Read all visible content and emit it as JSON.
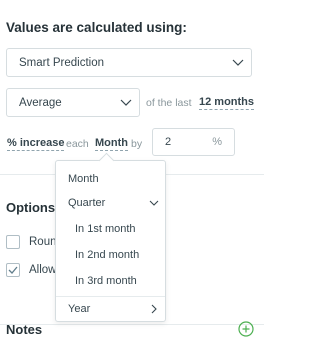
{
  "heading": "Values are calculated using:",
  "method_select": {
    "value": "Smart Prediction"
  },
  "aggregation_select": {
    "value": "Average"
  },
  "of_the_last": "of the last",
  "months_link": "12 months",
  "increase_link": "% increase",
  "each_text": "each",
  "period_link": "Month",
  "by_text": "by",
  "value_input": {
    "value": "2",
    "unit": "%"
  },
  "options": {
    "title": "Options",
    "round_label": "Roun",
    "round_checked": false,
    "allow_label": "Allow",
    "allow_checked": true
  },
  "notes": {
    "title": "Notes"
  },
  "period_menu": {
    "month": "Month",
    "quarter": "Quarter",
    "quarter_options": [
      "In 1st month",
      "In 2nd month",
      "In 3rd month"
    ],
    "year": "Year"
  },
  "colors": {
    "accent_green": "#4caf50",
    "text": "#37474f",
    "muted": "#8a979c"
  },
  "icons": {
    "chevron": "chevron-down-icon",
    "add_note": "plus-circle-icon",
    "check": "check-icon"
  }
}
